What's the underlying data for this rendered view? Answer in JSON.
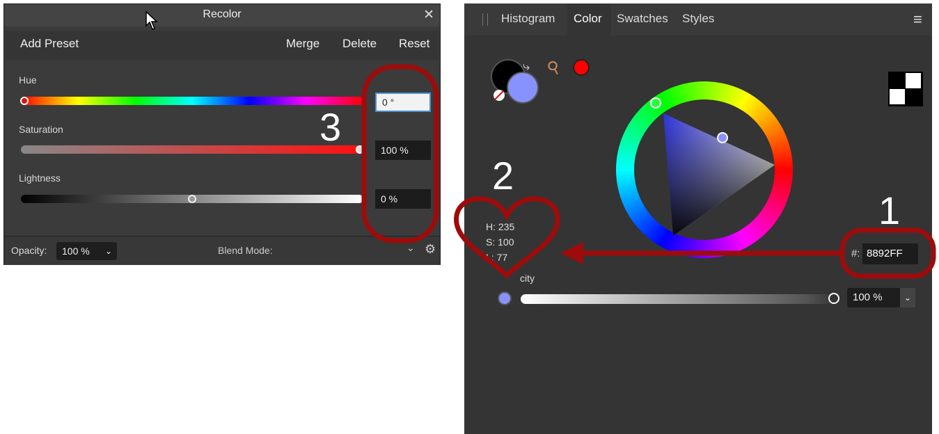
{
  "recolor": {
    "title": "Recolor",
    "toolbar": {
      "add_preset": "Add Preset",
      "merge": "Merge",
      "delete": "Delete",
      "reset": "Reset"
    },
    "sliders": {
      "hue": {
        "label": "Hue",
        "value": "0 °",
        "level": 0.0
      },
      "saturation": {
        "label": "Saturation",
        "value": "100 %",
        "level": 1.0
      },
      "lightness": {
        "label": "Lightness",
        "value": "0 %",
        "level": 0.5
      }
    },
    "bottom": {
      "opacity_label": "Opacity:",
      "opacity_value": "100 %",
      "blend_label": "Blend Mode:"
    }
  },
  "color_panel": {
    "tabs": [
      "Histogram",
      "Color",
      "Swatches",
      "Styles"
    ],
    "active_tab": "Color",
    "hsl": {
      "h": "H: 235",
      "s": "S: 100",
      "l": "L: 77"
    },
    "hex_prefix": "#:",
    "hex_value": "8892FF",
    "opacity_label_partial": "city",
    "opacity_value": "100 %",
    "fill_color": "#8892FF",
    "stroke_color": "#000000",
    "picker_color": "#FF0000"
  },
  "annotations": {
    "n1": "1",
    "n2": "2",
    "n3": "3",
    "color": "#9E0B0B"
  }
}
